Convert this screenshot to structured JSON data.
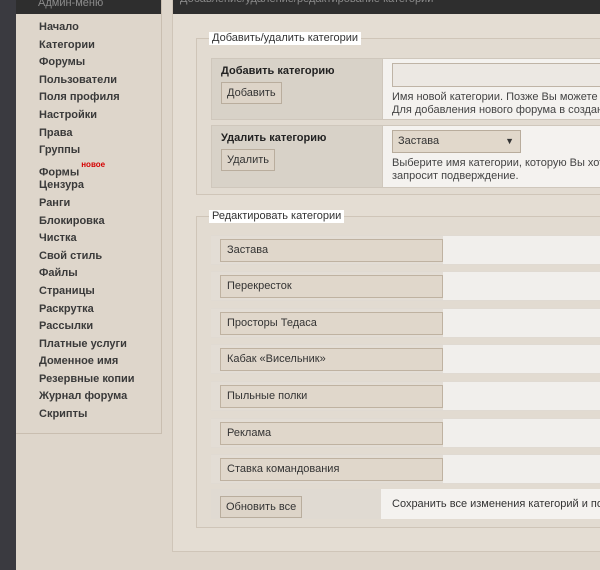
{
  "sidebar": {
    "title": "Админ-меню",
    "items": [
      {
        "label": "Начало"
      },
      {
        "label": "Категории"
      },
      {
        "label": "Форумы"
      },
      {
        "label": "Пользователи"
      },
      {
        "label": "Поля профиля"
      },
      {
        "label": "Настройки"
      },
      {
        "label": "Права"
      },
      {
        "label": "Группы"
      },
      {
        "label": "Формы",
        "badge": "новое"
      },
      {
        "label": "Цензура"
      },
      {
        "label": "Ранги"
      },
      {
        "label": "Блокировка"
      },
      {
        "label": "Чистка"
      },
      {
        "label": "Свой стиль"
      },
      {
        "label": "Файлы"
      },
      {
        "label": "Страницы"
      },
      {
        "label": "Раскрутка"
      },
      {
        "label": "Рассылки"
      },
      {
        "label": "Платные услуги"
      },
      {
        "label": "Доменное имя"
      },
      {
        "label": "Резервные копии"
      },
      {
        "label": "Журнал форума"
      },
      {
        "label": "Скрипты"
      }
    ]
  },
  "main": {
    "title": "Добавление/удаление/редактирование категорий",
    "add_delete": {
      "legend": "Добавить/удалить категории",
      "add": {
        "title": "Добавить категорию",
        "button": "Добавить",
        "input_value": "",
        "hint_line1": "Имя новой категории. Позже Вы можете и",
        "hint_line2": "Для добавления нового форума в созданн"
      },
      "delete": {
        "title": "Удалить категорию",
        "button": "Удалить",
        "selected": "Застава",
        "hint_line1": "Выберите имя категории, которую Вы хот",
        "hint_line2": "запросит подверждение."
      }
    },
    "edit": {
      "legend": "Редактировать категории",
      "categories": [
        "Застава",
        "Перекресток",
        "Просторы Тедаса",
        "Кабак «Висельник»",
        "Пыльные полки",
        "Реклама",
        "Ставка командования"
      ],
      "update_button": "Обновить все",
      "update_hint": "Сохранить все изменения категорий и поз"
    }
  },
  "colors": {
    "page_bg": "#3a3a40",
    "panel_bg": "#ded6cb",
    "header_bg": "#2e2e2e",
    "badge_red": "#d40000"
  }
}
